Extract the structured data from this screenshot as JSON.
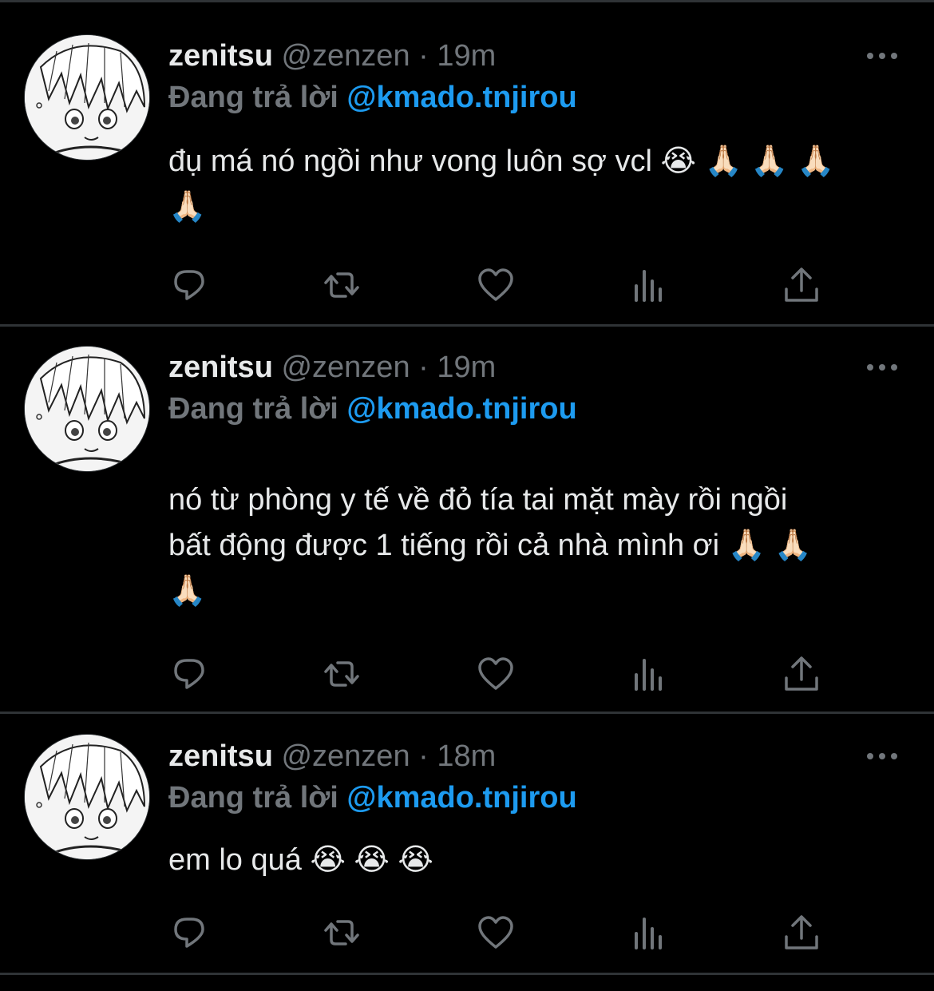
{
  "colors": {
    "background": "#000000",
    "text": "#e7e9ea",
    "muted": "#71767b",
    "accent": "#1d9bf0",
    "divider": "#2f3336"
  },
  "tweets": [
    {
      "name": "zenitsu",
      "handle": "@zenzen",
      "separator": "·",
      "time": "19m",
      "reply_label": "Đang trả lời",
      "mention": "@kmado.tnjirou",
      "text": "đụ má nó ngồi như vong luôn sợ vcl 😭 🙏🏻 🙏🏻 🙏🏻\n🙏🏻",
      "actions": [
        "reply-icon",
        "retweet-icon",
        "like-icon",
        "analytics-icon",
        "share-icon"
      ]
    },
    {
      "name": "zenitsu",
      "handle": "@zenzen",
      "separator": "·",
      "time": "19m",
      "reply_label": "Đang trả lời",
      "mention": "@kmado.tnjirou",
      "text": "nó từ phòng y tế về đỏ tía tai mặt mày rồi ngồi\nbất động được 1 tiếng rồi cả nhà mình ơi 🙏🏻 🙏🏻\n🙏🏻",
      "actions": [
        "reply-icon",
        "retweet-icon",
        "like-icon",
        "analytics-icon",
        "share-icon"
      ]
    },
    {
      "name": "zenitsu",
      "handle": "@zenzen",
      "separator": "·",
      "time": "18m",
      "reply_label": "Đang trả lời",
      "mention": "@kmado.tnjirou",
      "text": "em lo quá 😭 😭 😭",
      "actions": [
        "reply-icon",
        "retweet-icon",
        "like-icon",
        "analytics-icon",
        "share-icon"
      ]
    }
  ]
}
